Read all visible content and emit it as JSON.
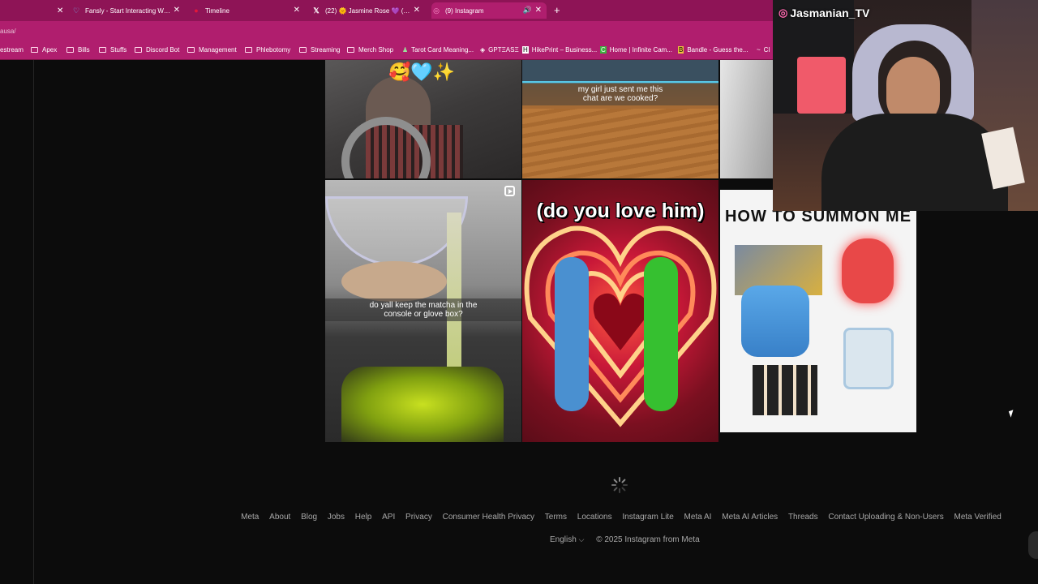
{
  "tabs": [
    {
      "title": "Fansly - Start Interacting With Y",
      "icon": "fansly-heart-icon"
    },
    {
      "title": "Timeline",
      "icon": "red-dot-icon"
    },
    {
      "title": "(22) 🌞 Jasmine Rose 💜 (@Je",
      "icon": "x-logo-icon"
    },
    {
      "title": "(9) Instagram",
      "icon": "instagram-icon",
      "active": true
    }
  ],
  "url": "ausa/",
  "bookmarks": [
    "estream",
    "Apex",
    "Bills",
    "Stuffs",
    "Discord Bot",
    "Management",
    "Phlebotomy",
    "Streaming",
    "Merch Shop",
    "Tarot Card Meaning...",
    "GPTΞASΞ",
    "HikePrint – Business...",
    "Home | Infinite Cam...",
    "Bandle - Guess the...",
    "Cl"
  ],
  "posts": {
    "top_middle_caption": "my girl just sent me this\nchat are we cooked?",
    "top_left_emojis": "🥰🩵✨",
    "matcha_caption": "do yall keep the matcha in the\nconsole or glove box?",
    "love_title": "(do you love him)",
    "summon_title": "HOW TO SUMMON ME"
  },
  "footer": {
    "links": [
      "Meta",
      "About",
      "Blog",
      "Jobs",
      "Help",
      "API",
      "Privacy",
      "Consumer Health Privacy",
      "Terms",
      "Locations",
      "Instagram Lite",
      "Meta AI",
      "Meta AI Articles",
      "Threads",
      "Contact Uploading & Non-Users",
      "Meta Verified"
    ],
    "language": "English",
    "copyright": "© 2025 Instagram from Meta"
  },
  "webcam": {
    "tag": "Jasmanian_TV"
  },
  "colors": {
    "chrome": "#8e1456",
    "chrome_light": "#b01e6e",
    "page_bg": "#0c0c0c",
    "footer_text": "#a8a8a8"
  }
}
